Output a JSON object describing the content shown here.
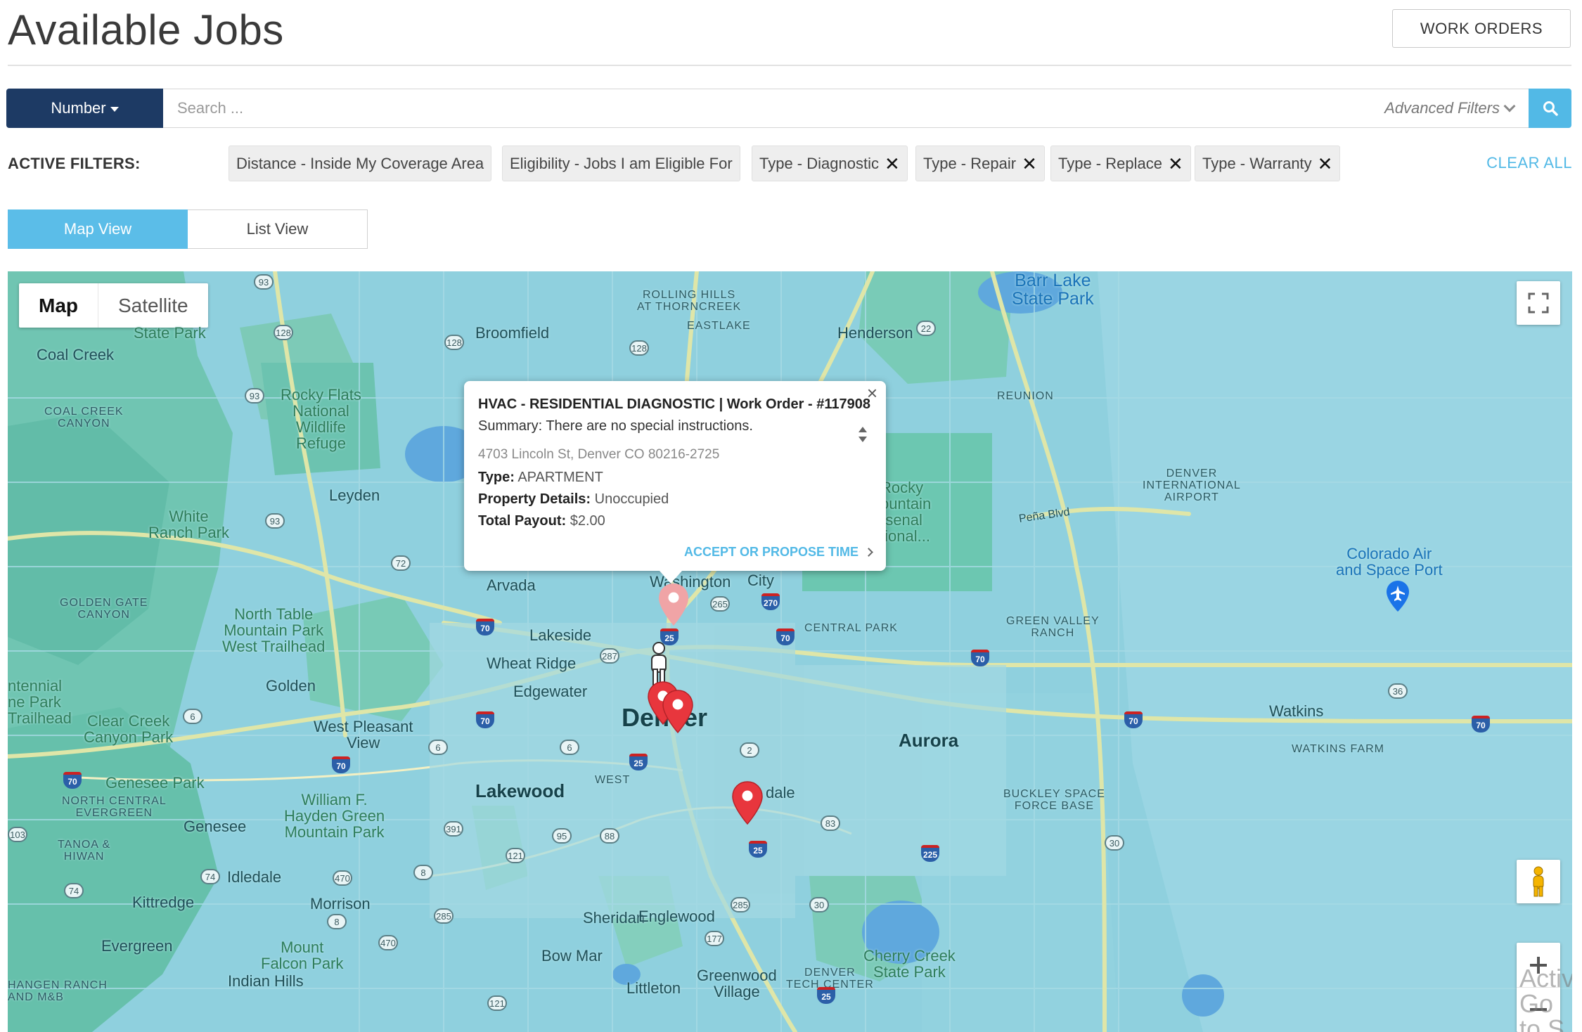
{
  "header": {
    "title": "Available Jobs",
    "work_orders_label": "WORK ORDERS"
  },
  "search": {
    "select_label": "Number",
    "placeholder": "Search ...",
    "value": "",
    "advanced_filters_label": "Advanced Filters"
  },
  "filters": {
    "label": "ACTIVE FILTERS:",
    "chips": [
      {
        "label": "Distance - Inside My Coverage Area",
        "removable": false
      },
      {
        "label": "Eligibility - Jobs I am Eligible For",
        "removable": false
      },
      {
        "label": "Type - Diagnostic",
        "removable": true
      },
      {
        "label": "Type - Repair",
        "removable": true
      },
      {
        "label": "Type - Replace",
        "removable": true
      },
      {
        "label": "Type - Warranty",
        "removable": true
      }
    ],
    "clear_all_label": "CLEAR ALL"
  },
  "views": {
    "map_label": "Map View",
    "list_label": "List View",
    "active": "map"
  },
  "map": {
    "type_map_label": "Map",
    "type_satellite_label": "Satellite",
    "active_type": "Map",
    "water_color": "#8fd0de",
    "park_color": "#6cc7b1",
    "pin_color": "#e8363d",
    "labels": {
      "barr_lake": "Barr Lake\nState Park",
      "henderson": "Henderson",
      "broomfield": "Broomfield",
      "rolling_hills": "ROLLING HILLS\nAT THORNCREEK",
      "eastlake": "EASTLAKE",
      "state_park": "State Park",
      "coal_creek": "Coal Creek",
      "coal_creek_canyon": "COAL CREEK\nCANYON",
      "rocky_flats": "Rocky Flats\nNational\nWildlife\nRefuge",
      "reunion": "REUNION",
      "leyden": "Leyden",
      "white_ranch": "White\nRanch Park",
      "denver_intl": "DENVER\nINTERNATIONAL\nAIRPORT",
      "pena_blvd": "Peña Blvd",
      "colorado_air": "Colorado Air\nand Space Port",
      "golden_gate": "GOLDEN GATE\nCANYON",
      "north_table": "North Table\nMountain Park\nWest Trailhead",
      "arvada": "Arvada",
      "lakeside": "Lakeside",
      "wheat_ridge": "Wheat Ridge",
      "edgewater": "Edgewater",
      "golden": "Golden",
      "green_valley": "GREEN VALLEY\nRANCH",
      "central_park": "CENTRAL PARK",
      "centennial": "ntennial\nne Park\nTrailhead",
      "clear_creek": "Clear Creek\nCanyon Park",
      "west_pleasant": "West Pleasant\nView",
      "denver": "Denver",
      "aurora": "Aurora",
      "watkins": "Watkins",
      "watkins_farm": "WATKINS FARM",
      "genesee_park": "Genesee Park",
      "north_central": "NORTH CENTRAL\nEVERGREEN",
      "william_hayden": "William F.\nHayden Green\nMountain Park",
      "lakewood": "Lakewood",
      "west": "WEST",
      "buckley": "BUCKLEY SPACE\nFORCE BASE",
      "genesee": "Genesee",
      "tanoa": "TANOA &\nHIWAN",
      "idledale": "Idledale",
      "morrison": "Morrison",
      "kittredge": "Kittredge",
      "sheridan": "Sheridan",
      "englewood": "Englewood",
      "evergreen": "Evergreen",
      "mount_falcon": "Mount\nFalcon Park",
      "indian_hills": "Indian Hills",
      "bow_mar": "Bow Mar",
      "littleton": "Littleton",
      "greenwood": "Greenwood\nVillage",
      "dtc": "DENVER\nTECH CENTER",
      "cherry_creek": "Cherry Creek\nState Park",
      "hangen_ranch": "HANGEN RANCH\nAND M&B",
      "washington": "Washington",
      "city": "City",
      "glendale": "dale",
      "rocky_mountain": "Rocky\nountain\nrsenal\ntional..."
    },
    "watermark": "Activ\nGo to S"
  },
  "popup": {
    "title": "HVAC - RESIDENTIAL DIAGNOSTIC | Work Order - #117908",
    "summary": "Summary: There are no special instructions.",
    "address": "4703 Lincoln St, Denver CO 80216-2725",
    "type_label": "Type:",
    "type_value": "APARTMENT",
    "property_label": "Property Details:",
    "property_value": "Unoccupied",
    "payout_label": "Total Payout:",
    "payout_value": "$2.00",
    "action_label": "ACCEPT OR PROPOSE TIME"
  }
}
